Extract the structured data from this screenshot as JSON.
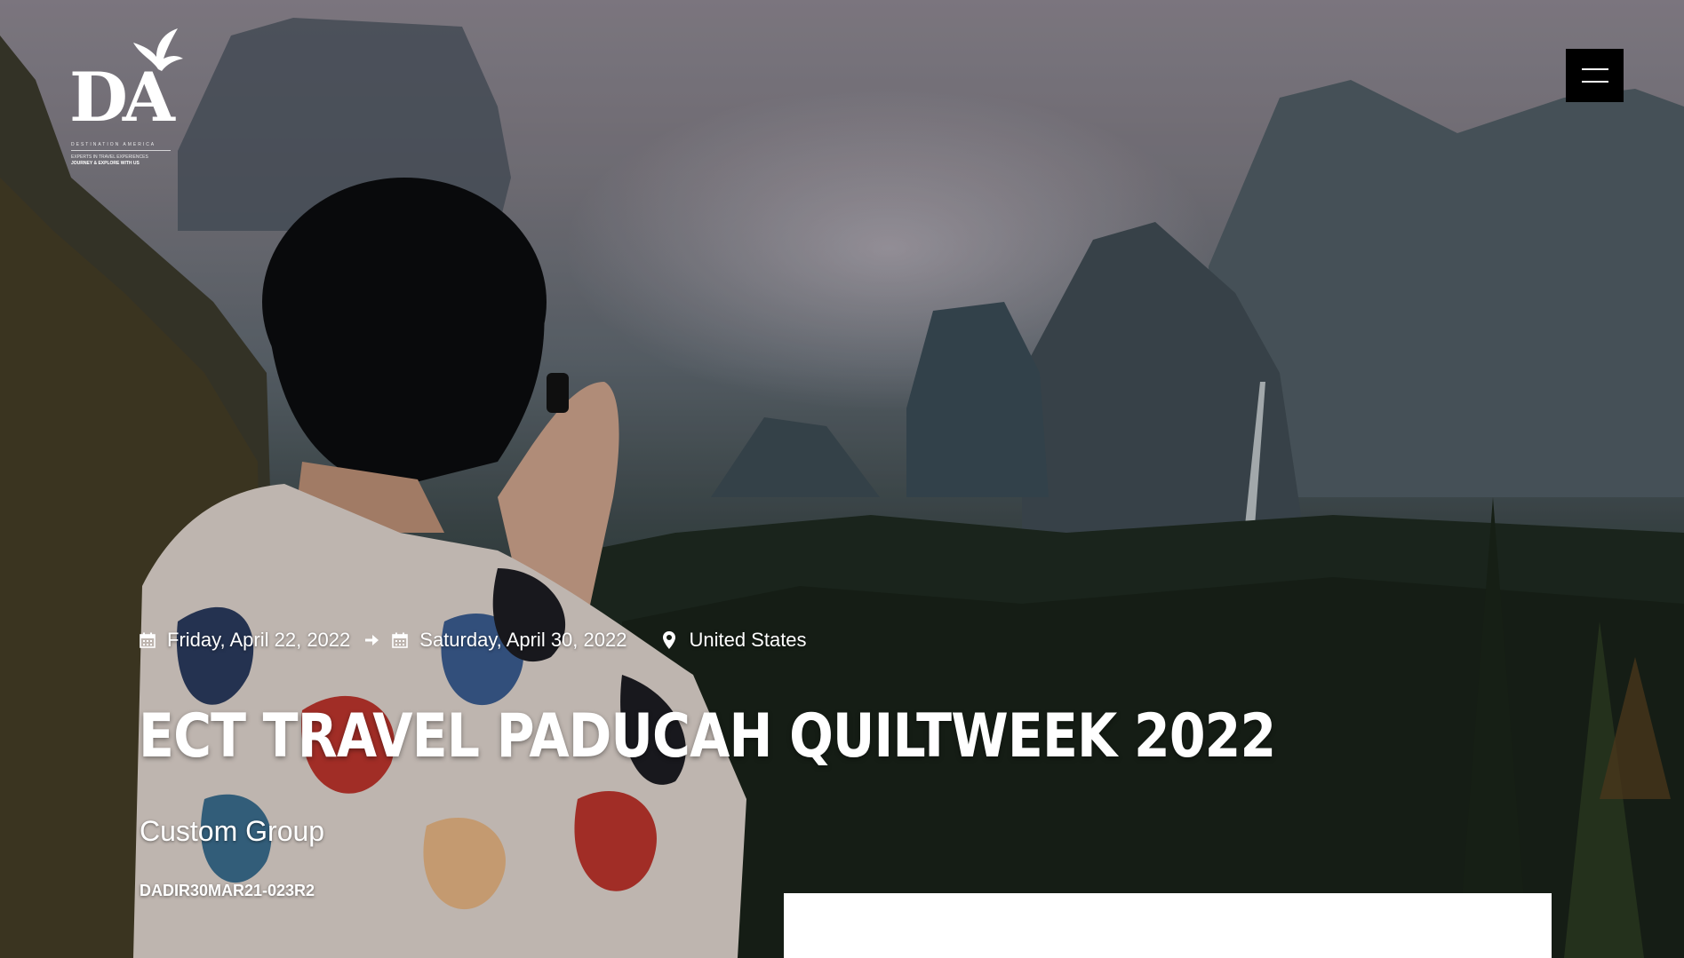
{
  "brand": {
    "logo_mark": "DA",
    "logo_line1": "DESTINATION AMERICA",
    "logo_line2": "EXPERTS IN TRAVEL EXPERIENCES",
    "logo_line3": "JOURNEY & EXPLORE WITH US",
    "logo_icon": "eagle-icon"
  },
  "header": {
    "menu_icon": "hamburger-menu-icon"
  },
  "trip": {
    "start_date": "Friday, April 22, 2022",
    "end_date": "Saturday, April 30, 2022",
    "location": "United States",
    "title": "ECT TRAVEL PADUCAH QUILTWEEK 2022",
    "subtitle": "Custom Group",
    "code": "DADIR30MAR21-023R2"
  },
  "icons": {
    "start_date_icon": "calendar-icon",
    "arrow_icon": "arrow-right-icon",
    "end_date_icon": "calendar-icon",
    "location_icon": "map-marker-icon"
  },
  "colors": {
    "text": "#ffffff",
    "menu_bg": "#000000",
    "card_bg": "#ffffff"
  }
}
